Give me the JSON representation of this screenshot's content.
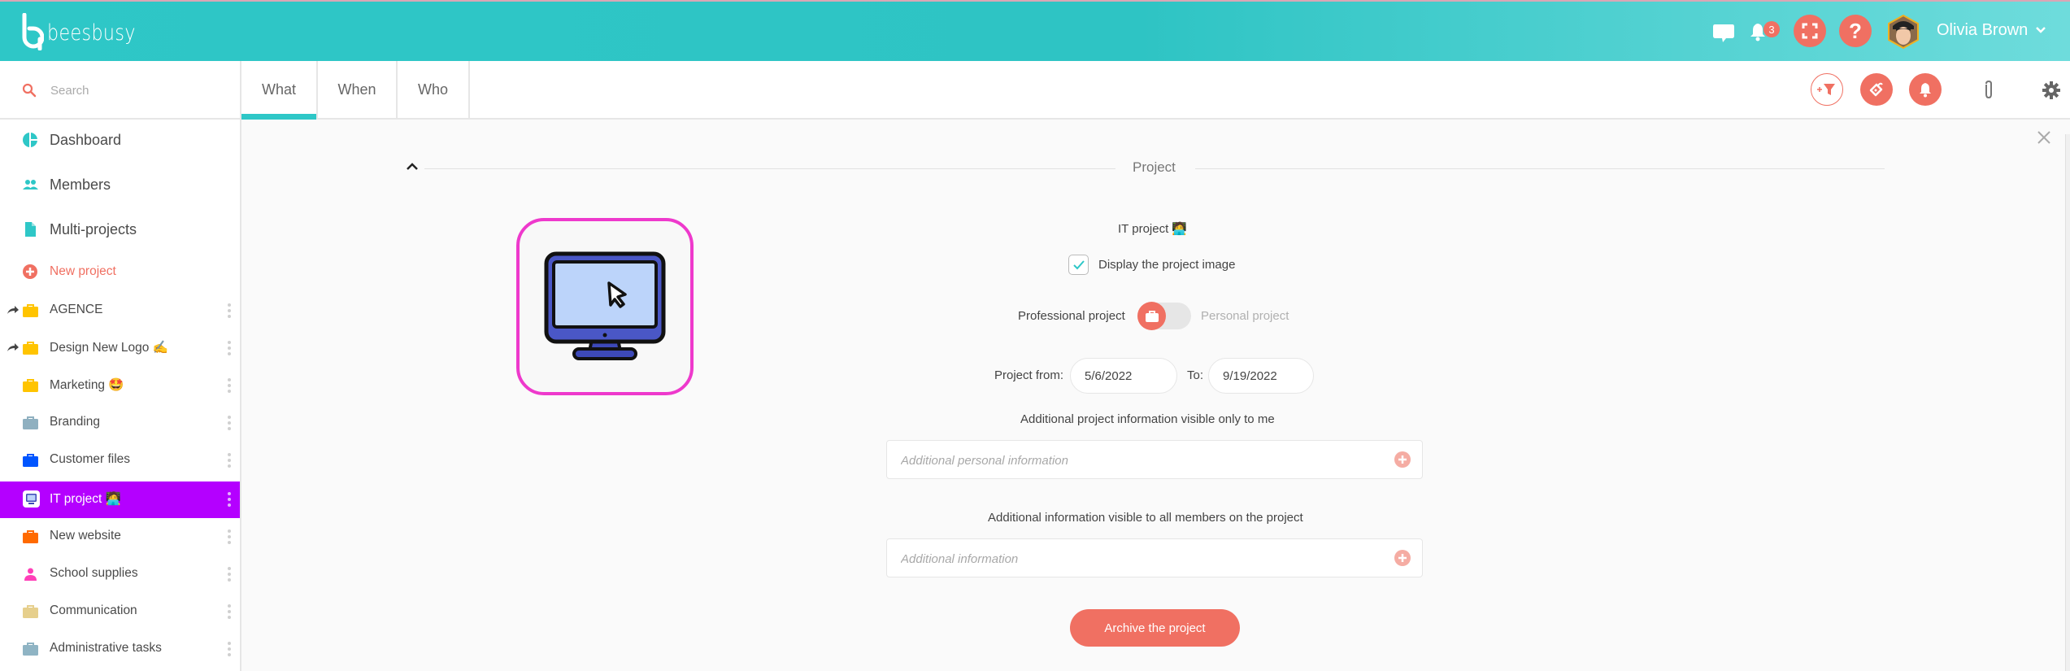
{
  "app": {
    "brand": "beesbusy",
    "colors": {
      "primary": "#2ec7c7",
      "accent": "#f07062",
      "active_project": "#b400ff",
      "image_border": "#ee39cc"
    }
  },
  "header": {
    "icons": [
      "chat-icon",
      "bell-icon",
      "fullscreen-icon",
      "help-icon"
    ],
    "notification_count": "3",
    "help_label": "?",
    "user_name": "Olivia Brown"
  },
  "sidebar": {
    "search_placeholder": "Search",
    "nav": [
      {
        "label": "Dashboard",
        "icon": "pie-chart-icon"
      },
      {
        "label": "Members",
        "icon": "people-icon"
      },
      {
        "label": "Multi-projects",
        "icon": "document-icon"
      },
      {
        "label": "New project",
        "icon": "plus-circle-icon"
      }
    ],
    "projects": [
      {
        "label": "AGENCE",
        "color": "#ffc400",
        "shared": true
      },
      {
        "label": "Design New Logo ✍️",
        "color": "#ffc400",
        "shared": true
      },
      {
        "label": "Marketing 🤩",
        "color": "#ffc400",
        "shared": false
      },
      {
        "label": "Branding",
        "color": "#8fb0c0",
        "shared": false
      },
      {
        "label": "Customer files",
        "color": "#0055ff",
        "shared": false
      },
      {
        "label": "IT project 🧑‍💻",
        "color": "#ffffff",
        "shared": false,
        "active": true
      },
      {
        "label": "New website",
        "color": "#ff6a00",
        "shared": false
      },
      {
        "label": "School supplies",
        "color": "#ff3fb8",
        "shared": false,
        "icon": "person-icon"
      },
      {
        "label": "Communication",
        "color": "#e6cf8c",
        "shared": false
      },
      {
        "label": "Administrative tasks",
        "color": "#8fb4c4",
        "shared": false
      }
    ]
  },
  "tabs": [
    {
      "label": "What",
      "active": true
    },
    {
      "label": "When",
      "active": false
    },
    {
      "label": "Who",
      "active": false
    }
  ],
  "toolbar": {
    "icons": [
      "add-filter-icon",
      "tag-icon",
      "bell-icon",
      "paperclip-icon",
      "gear-icon"
    ]
  },
  "project_panel": {
    "section_title": "Project",
    "project_name": "IT project 🧑‍💻",
    "display_image_label": "Display the project image",
    "display_image_checked": true,
    "professional_label": "Professional project",
    "personal_label": "Personal project",
    "type_selected": "Professional project",
    "from_label": "Project from:",
    "from_date": "5/6/2022",
    "to_label": "To:",
    "to_date": "9/19/2022",
    "private_info_label": "Additional project information visible only to me",
    "private_info_placeholder": "Additional personal information",
    "public_info_label": "Additional information visible to all members on the project",
    "public_info_placeholder": "Additional information",
    "archive_label": "Archive the project"
  }
}
